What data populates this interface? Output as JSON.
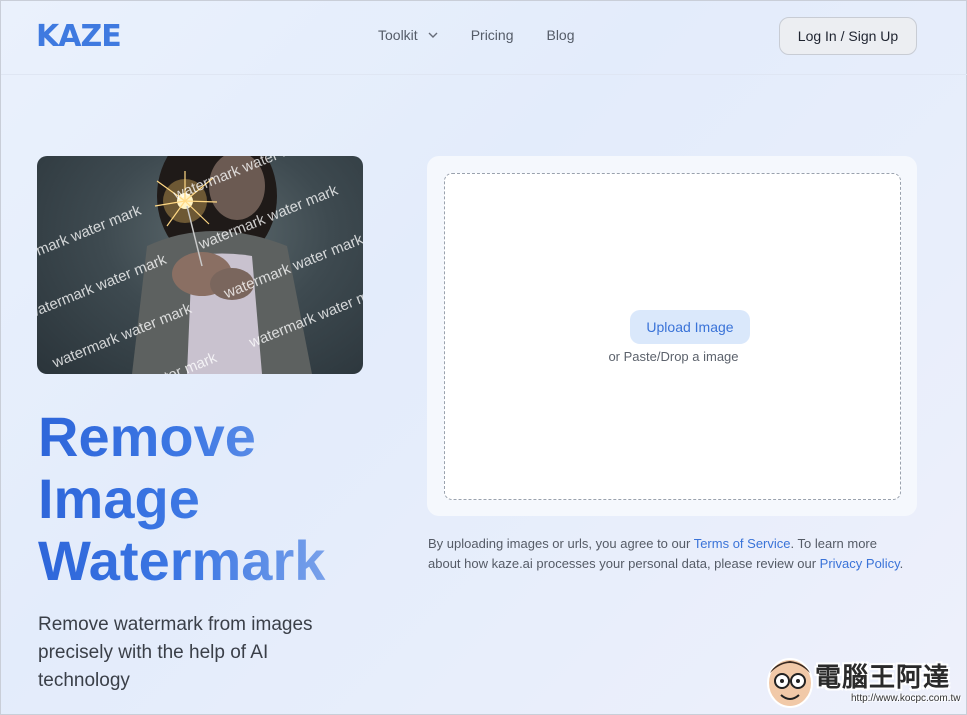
{
  "header": {
    "logo_text": "KAZE",
    "nav": [
      {
        "label": "Toolkit",
        "has_dropdown": true
      },
      {
        "label": "Pricing",
        "has_dropdown": false
      },
      {
        "label": "Blog",
        "has_dropdown": false
      }
    ],
    "login_label": "Log In / Sign Up"
  },
  "hero": {
    "image_watermark_text": "watermark water mark",
    "title_lines": [
      "Remove",
      "Image",
      "Watermark"
    ],
    "subtitle": "Remove watermark from images precisely with the help of AI technology"
  },
  "upload": {
    "button_label": "Upload Image",
    "hint": "or Paste/Drop a image"
  },
  "legal": {
    "prefix": "By uploading images or urls, you agree to our ",
    "tos_link": "Terms of Service",
    "middle": ". To learn more about how kaze.ai processes your personal data, please review our ",
    "privacy_link": "Privacy Policy",
    "suffix": "."
  },
  "site_badge": {
    "text": "電腦王阿達",
    "url": "http://www.kocpc.com.tw"
  },
  "colors": {
    "accent": "#3a73d8",
    "title_gradient_start": "#2e66da",
    "title_gradient_end": "#8fb0ec"
  }
}
